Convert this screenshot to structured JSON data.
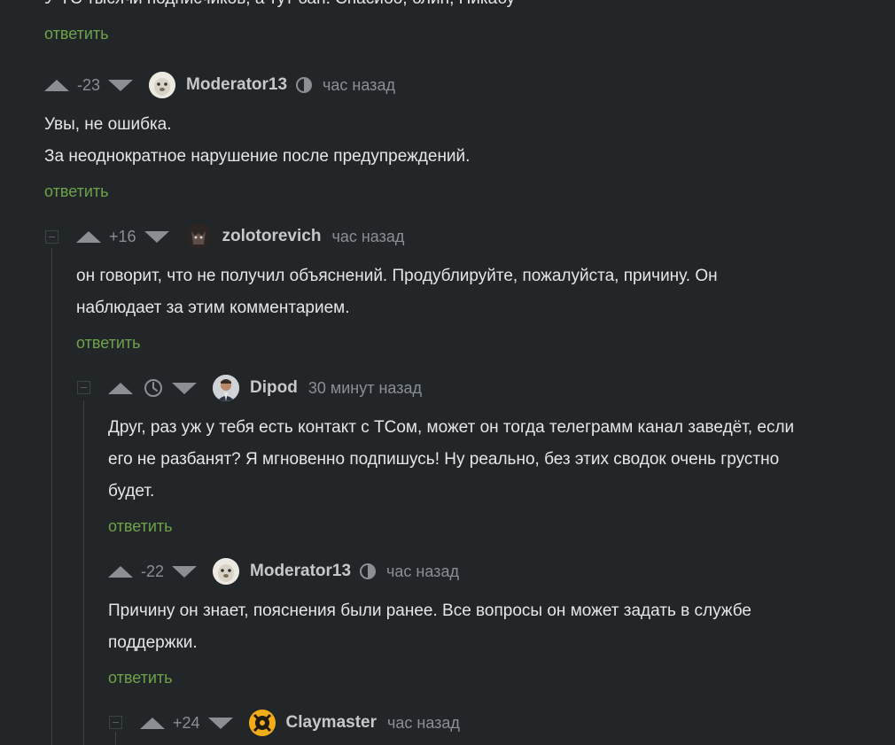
{
  "top_fragment": "У ТС тысячи подписчиков, а тут бан. Спасибо, блин, Пикабу",
  "reply_label": "ответить",
  "comments": [
    {
      "rating": "-23",
      "user": "Moderator13",
      "time": "час назад",
      "lines": [
        "Увы, не ошибка.",
        "За неоднократное нарушение после предупреждений."
      ]
    },
    {
      "rating": "+16",
      "user": "zolotorevich",
      "time": "час назад",
      "lines": [
        "он говорит, что не получил объяснений. Продублируйте, пожалуйста, причину. Он",
        "наблюдает за этим комментарием."
      ]
    },
    {
      "rating": "",
      "user": "Dipod",
      "time": "30 минут назад",
      "lines": [
        "Друг, раз уж у тебя есть контакт с ТСом, может он тогда телеграмм канал заведёт, если",
        "его не разбанят? Я мгновенно подпишусь! Ну реально, без этих сводок очень грустно",
        "будет."
      ]
    },
    {
      "rating": "-22",
      "user": "Moderator13",
      "time": "час назад",
      "lines": [
        "Причину он знает, пояснения были ранее. Все вопросы он может задать в службе",
        "поддержки."
      ]
    },
    {
      "rating": "+24",
      "user": "Claymaster",
      "time": "час назад",
      "lines": []
    }
  ]
}
